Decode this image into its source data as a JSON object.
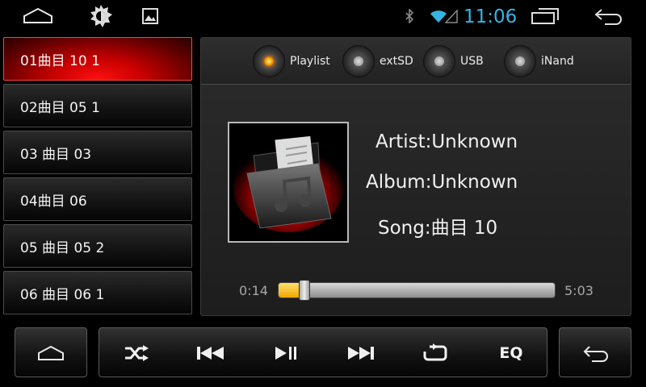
{
  "status_bar": {
    "clock": "11:06",
    "icons": [
      "home-icon",
      "brightness-icon",
      "gallery-icon",
      "bluetooth-icon",
      "wifi-icon",
      "signal-icon",
      "recent-apps-icon",
      "back-icon"
    ],
    "clock_color": "#33b5e5"
  },
  "playlist": {
    "selected_index": 0,
    "items": [
      {
        "label": "01曲目 10 1"
      },
      {
        "label": "02曲目 05 1"
      },
      {
        "label": "03 曲目 03"
      },
      {
        "label": "04曲目 06"
      },
      {
        "label": "05 曲目 05 2"
      },
      {
        "label": "06 曲目 06 1"
      }
    ]
  },
  "sources": {
    "selected": "Playlist",
    "items": [
      {
        "label": "Playlist"
      },
      {
        "label": "extSD"
      },
      {
        "label": "USB"
      },
      {
        "label": "iNand"
      }
    ]
  },
  "track_info": {
    "artist": "Artist:Unknown",
    "album": "Album:Unknown",
    "song": "Song:曲目 10",
    "album_art_icon": "music-folder-icon"
  },
  "progress": {
    "elapsed": "0:14",
    "total": "5:03",
    "fraction": 0.046
  },
  "controls": {
    "icons": [
      "home-icon",
      "shuffle-icon",
      "previous-icon",
      "play-pause-icon",
      "next-icon",
      "repeat-icon",
      "back-icon"
    ],
    "eq_label": "EQ"
  },
  "colors": {
    "accent_selected": "#e00000",
    "progress_fill": "#f0a800"
  }
}
